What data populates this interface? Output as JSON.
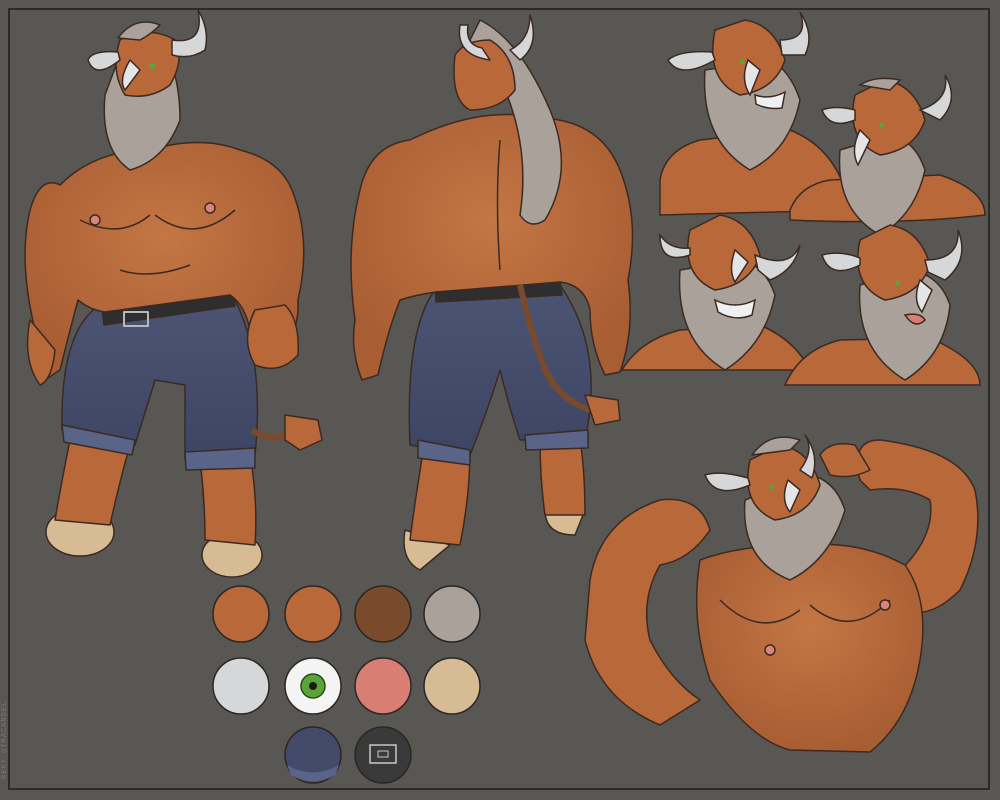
{
  "signature": "BEKY @IRACANDEL",
  "colors": {
    "background": "#595754",
    "fur_main": "#b9683a",
    "fur_shade": "#a85d33",
    "fur_dark": "#7a4a2c",
    "mane": "#a9a19a",
    "horn": "#d6d7d8",
    "eye_green": "#5aa43a",
    "nose_pink": "#d97e72",
    "hoof": "#d6bb94",
    "jeans": "#434a6a",
    "belt": "#3a3a3a"
  },
  "swatches": [
    {
      "name": "fur-main-swatch",
      "color": "#b9683a"
    },
    {
      "name": "fur-textured-swatch",
      "color": "#b9683a"
    },
    {
      "name": "fur-dark-swatch",
      "color": "#7a4a2c"
    },
    {
      "name": "mane-swatch",
      "color": "#a9a19a"
    },
    {
      "name": "horn-swatch",
      "color": "#d6d7d8"
    },
    {
      "name": "eye-swatch",
      "color": "#5aa43a"
    },
    {
      "name": "nose-swatch",
      "color": "#d97e72"
    },
    {
      "name": "hoof-swatch",
      "color": "#d6bb94"
    },
    {
      "name": "jeans-swatch",
      "color": "#434a6a"
    },
    {
      "name": "belt-swatch",
      "color": "#3a3a3a"
    }
  ]
}
